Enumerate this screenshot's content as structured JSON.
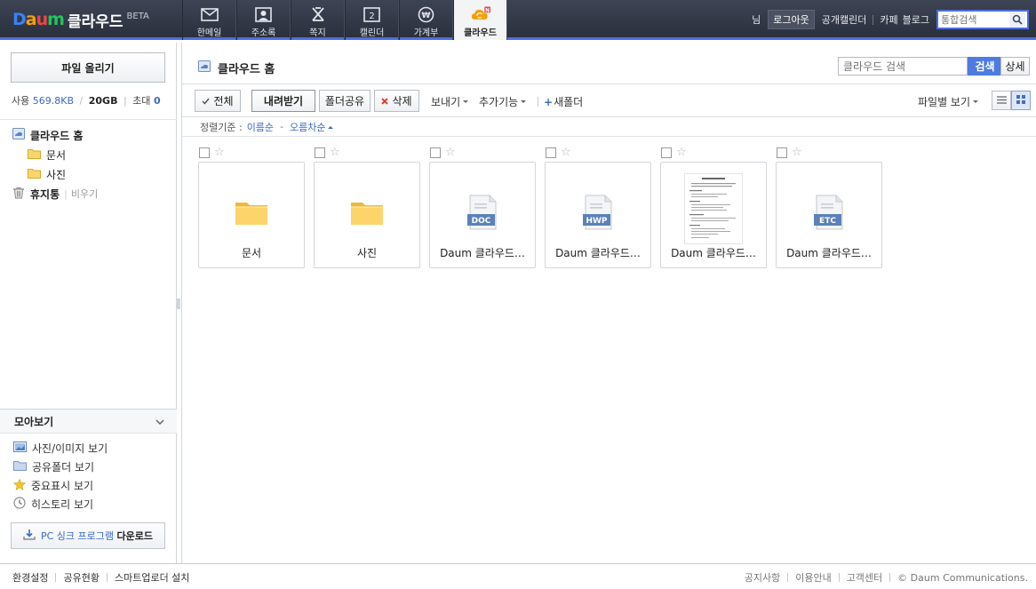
{
  "app": {
    "logo_daum": [
      "D",
      "a",
      "u",
      "m"
    ],
    "logo_service": "클라우드",
    "logo_beta": "BETA"
  },
  "nav": [
    {
      "label": "한메일",
      "icon": "mail-icon"
    },
    {
      "label": "주소록",
      "icon": "contacts-icon"
    },
    {
      "label": "쪽지",
      "icon": "note-icon"
    },
    {
      "label": "캘린더",
      "icon": "calendar-icon",
      "icon_text": "2"
    },
    {
      "label": "가계부",
      "icon": "account-book-icon",
      "icon_text": "₩"
    },
    {
      "label": "클라우드",
      "icon": "cloud-icon",
      "badge": "N",
      "active": true
    }
  ],
  "topright": {
    "user_suffix": "님",
    "logout": "로그아웃",
    "public_calendar": "공개캘린더",
    "cafe": "카페",
    "blog": "블로그",
    "search_placeholder": "통합검색"
  },
  "sidebar": {
    "upload": "파일 올리기",
    "usage_label": "사용",
    "usage_used": "569.8KB",
    "usage_total": "20GB",
    "invite_label": "초대",
    "invite_count": "0",
    "tree": {
      "home": "클라우드 홈",
      "folders": [
        "문서",
        "사진"
      ],
      "trash": "휴지통",
      "trash_empty": "비우기"
    },
    "moa": "모아보기",
    "moa_items": [
      {
        "label": "사진/이미지 보기",
        "icon": "image-icon"
      },
      {
        "label": "공유폴더 보기",
        "icon": "shared-folder-icon"
      },
      {
        "label": "중요표시 보기",
        "icon": "star-icon"
      },
      {
        "label": "히스토리 보기",
        "icon": "history-icon"
      }
    ],
    "pcsync_blue": "PC 싱크 프로그램",
    "pcsync_black": "다운로드"
  },
  "main": {
    "crumb": "클라우드 홈",
    "search_placeholder": "클라우드 검색",
    "search_btn": "검색",
    "detail_btn": "상세",
    "toolbar": {
      "select_all": "전체",
      "download": "내려받기",
      "share": "폴더공유",
      "delete": "삭제",
      "send": "보내기",
      "more": "추가기능",
      "new_folder": "새폴더",
      "view_by": "파일별 보기"
    },
    "sort": {
      "label": "정렬기준 :",
      "by": "이름순",
      "order": "오름차순"
    },
    "items": [
      {
        "name": "문서",
        "type": "folder"
      },
      {
        "name": "사진",
        "type": "folder"
      },
      {
        "name": "Daum 클라우드…",
        "type": "file",
        "ext": "DOC"
      },
      {
        "name": "Daum 클라우드…",
        "type": "file",
        "ext": "HWP"
      },
      {
        "name": "Daum 클라우드…",
        "type": "document-preview"
      },
      {
        "name": "Daum 클라우드…",
        "type": "file",
        "ext": "ETC"
      }
    ]
  },
  "footer": {
    "left": [
      "환경설정",
      "공유현황",
      "스마트업로더 설치"
    ],
    "right": [
      "공지사항",
      "이용안내",
      "고객센터",
      "© Daum Communications."
    ]
  },
  "colors": {
    "topbar": "#2f3543",
    "accent": "#4f6ee0",
    "link": "#3c69c7",
    "folder": "#f6c94c",
    "file_badge": "#5b82b8"
  }
}
